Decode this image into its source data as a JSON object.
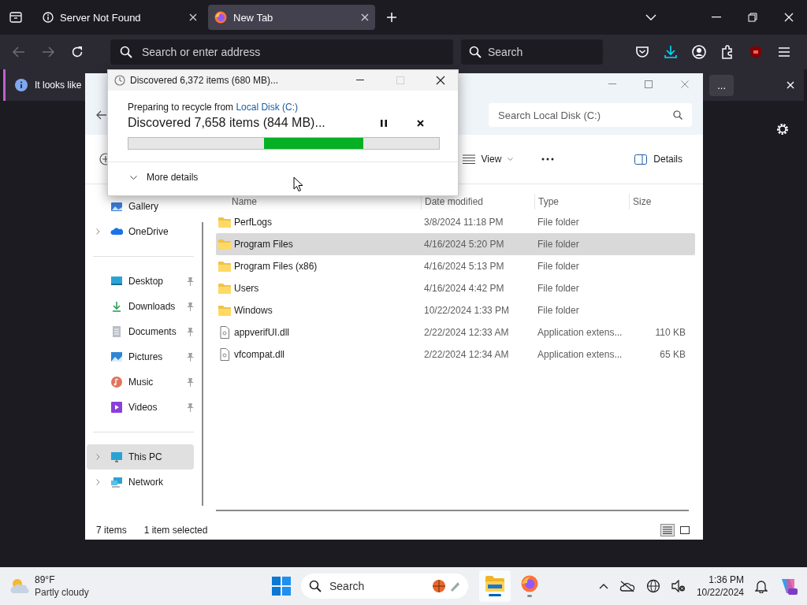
{
  "browser": {
    "tabs": [
      {
        "title": "Server Not Found",
        "kind": "error",
        "selected": false
      },
      {
        "title": "New Tab",
        "kind": "newtab",
        "selected": true
      }
    ],
    "address_bar": {
      "placeholder": "Search or enter address"
    },
    "search_bar": {
      "placeholder": "Search"
    },
    "notification": {
      "text": "It looks like",
      "button": "..."
    }
  },
  "explorer": {
    "search": {
      "placeholder": "Search Local Disk (C:)"
    },
    "toolbar": [
      {
        "kind": "view",
        "label": "View"
      },
      {
        "kind": "more"
      },
      {
        "kind": "details",
        "label": "Details"
      }
    ],
    "sidebar": [
      {
        "kind": "gallery",
        "label": "Gallery",
        "expandable": false,
        "pinned": false,
        "selected": false
      },
      {
        "kind": "cloud",
        "label": "OneDrive",
        "expandable": true,
        "pinned": false,
        "selected": false
      },
      {
        "kind": "divider"
      },
      {
        "kind": "desktop",
        "label": "Desktop",
        "expandable": false,
        "pinned": true,
        "selected": false
      },
      {
        "kind": "download",
        "label": "Downloads",
        "expandable": false,
        "pinned": true,
        "selected": false
      },
      {
        "kind": "document",
        "label": "Documents",
        "expandable": false,
        "pinned": true,
        "selected": false
      },
      {
        "kind": "pictures",
        "label": "Pictures",
        "expandable": false,
        "pinned": true,
        "selected": false
      },
      {
        "kind": "music",
        "label": "Music",
        "expandable": false,
        "pinned": true,
        "selected": false
      },
      {
        "kind": "video",
        "label": "Videos",
        "expandable": false,
        "pinned": true,
        "selected": false
      },
      {
        "kind": "divider"
      },
      {
        "kind": "pc",
        "label": "This PC",
        "expandable": true,
        "pinned": false,
        "selected": true
      },
      {
        "kind": "network",
        "label": "Network",
        "expandable": true,
        "pinned": false,
        "selected": false
      }
    ],
    "columns": [
      "Name",
      "Date modified",
      "Type",
      "Size"
    ],
    "rows": [
      {
        "kind": "folder",
        "name": "PerfLogs",
        "date": "3/8/2024 11:18 PM",
        "type": "File folder",
        "selected": false
      },
      {
        "kind": "folder",
        "name": "Program Files",
        "date": "4/16/2024 5:20 PM",
        "type": "File folder",
        "selected": true
      },
      {
        "kind": "folder",
        "name": "Program Files (x86)",
        "date": "4/16/2024 5:13 PM",
        "type": "File folder",
        "selected": false
      },
      {
        "kind": "folder",
        "name": "Users",
        "date": "4/16/2024 4:42 PM",
        "type": "File folder",
        "selected": false
      },
      {
        "kind": "folder",
        "name": "Windows",
        "date": "10/22/2024 1:33 PM",
        "type": "File folder",
        "selected": false
      },
      {
        "kind": "file",
        "name": "appverifUI.dll",
        "date": "2/22/2024 12:33 AM",
        "type": "Application extens...",
        "size": "110 KB",
        "selected": false
      },
      {
        "kind": "file",
        "name": "vfcompat.dll",
        "date": "2/22/2024 12:34 AM",
        "type": "Application extens...",
        "size": "65 KB",
        "selected": false
      }
    ],
    "status": {
      "count": "7 items",
      "selection": "1 item selected"
    },
    "view_modes": [
      {
        "kind": "details",
        "selected": true
      },
      {
        "kind": "tiles",
        "selected": false
      }
    ]
  },
  "dialog": {
    "title": "Discovered 6,372 items (680 MB)...",
    "source_label": "Preparing to recycle from",
    "source_link": "Local Disk (C:)",
    "status": "Discovered 7,658 items (844 MB)...",
    "progress": {
      "indeterminate": true
    },
    "more": "More details"
  },
  "taskbar": {
    "weather": {
      "temperature": "89°F",
      "condition": "Partly cloudy"
    },
    "search": {
      "placeholder": "Search"
    },
    "apps": [
      {
        "kind": "explorer",
        "active": true
      },
      {
        "kind": "firefox",
        "active": false
      }
    ],
    "clock": {
      "time": "1:36 PM",
      "date": "10/22/2024"
    }
  }
}
